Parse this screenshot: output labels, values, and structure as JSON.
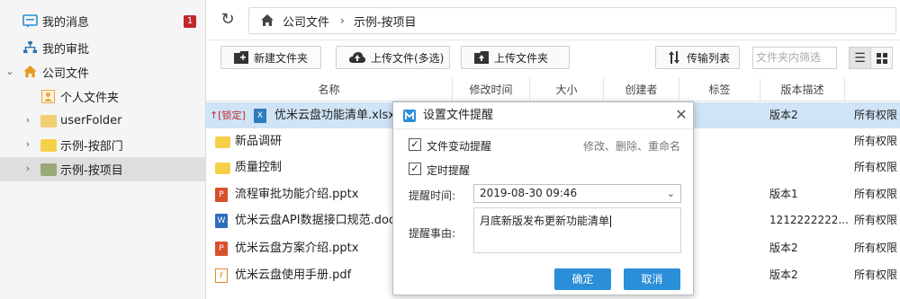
{
  "sidebar": {
    "items": [
      {
        "label": "我的消息",
        "badge": "1",
        "icon": "message-icon"
      },
      {
        "label": "我的审批",
        "icon": "org-chart-icon"
      },
      {
        "label": "公司文件",
        "icon": "home-icon",
        "expanded": true
      },
      {
        "label": "个人文件夹",
        "icon": "person-folder-icon"
      },
      {
        "label": "userFolder",
        "icon": "folder-icon"
      },
      {
        "label": "示例-按部门",
        "icon": "folder-icon"
      },
      {
        "label": "示例-按项目",
        "icon": "folder-icon",
        "selected": true
      }
    ]
  },
  "breadcrumb": {
    "root": "公司文件",
    "current": "示例-按项目"
  },
  "toolbar": {
    "new_folder": "新建文件夹",
    "upload_multi": "上传文件(多选)",
    "upload_folder": "上传文件夹",
    "transfer_list": "传输列表",
    "filter_placeholder": "文件夹内筛选"
  },
  "table": {
    "columns": [
      "名称",
      "修改时间",
      "大小",
      "创建者",
      "标签",
      "版本描述"
    ],
    "rows": [
      {
        "lock": "[锁定]",
        "name": "优米云盘功能清单.xlsx",
        "type": "xlsx",
        "version": "版本2",
        "perm": "所有权限"
      },
      {
        "name": "新品调研",
        "type": "folder",
        "version": "",
        "perm": "所有权限"
      },
      {
        "name": "质量控制",
        "type": "folder",
        "version": "",
        "perm": "所有权限"
      },
      {
        "name": "流程审批功能介绍.pptx",
        "type": "pptx",
        "version": "版本1",
        "perm": "所有权限"
      },
      {
        "name": "优米云盘API数据接口规范.docx",
        "type": "docx",
        "version": "1212222222...",
        "perm": "所有权限"
      },
      {
        "name": "优米云盘方案介绍.pptx",
        "type": "pptx",
        "version": "版本2",
        "perm": "所有权限"
      },
      {
        "name": "优米云盘使用手册.pdf",
        "type": "pdf",
        "version": "版本2",
        "perm": "所有权限"
      }
    ]
  },
  "dialog": {
    "title": "设置文件提醒",
    "file_change_label": "文件变动提醒",
    "file_change_hint": "修改、删除、重命名",
    "timed_label": "定时提醒",
    "time_label": "提醒时间:",
    "time_value": "2019-08-30 09:46",
    "reason_label": "提醒事由:",
    "reason_value": "月底新版发布更新功能清单",
    "ok": "确定",
    "cancel": "取消"
  },
  "colors": {
    "accent": "#2a8ed8",
    "selected_row": "#cfe4f6",
    "badge": "#c0282a",
    "lock": "#c0282a"
  }
}
